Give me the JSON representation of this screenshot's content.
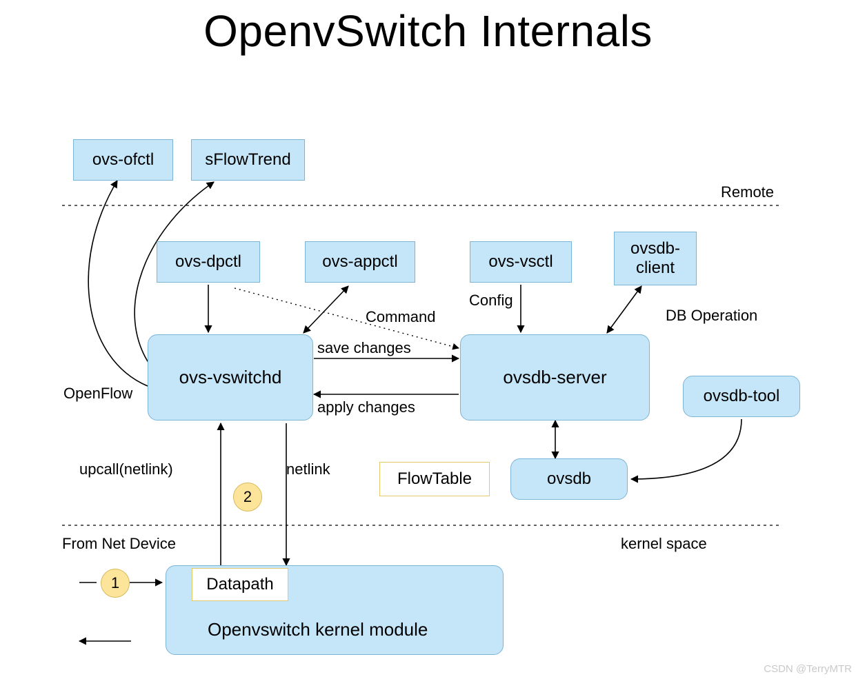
{
  "title": "OpenvSwitch Internals",
  "nodes": {
    "ovs_ofctl": "ovs-ofctl",
    "sflowtrend": "sFlowTrend",
    "ovs_dpctl": "ovs-dpctl",
    "ovs_appctl": "ovs-appctl",
    "ovs_vsctl": "ovs-vsctl",
    "ovsdb_client": "ovsdb-\nclient",
    "ovs_vswitchd": "ovs-vswitchd",
    "ovsdb_server": "ovsdb-server",
    "ovsdb_tool": "ovsdb-tool",
    "ovsdb": "ovsdb",
    "flowtable": "FlowTable",
    "datapath": "Datapath",
    "kernel_module": "Openvswitch kernel module"
  },
  "labels": {
    "remote": "Remote",
    "openflow": "OpenFlow",
    "command": "Command",
    "config": "Config",
    "db_operation": "DB Operation",
    "save_changes": "save changes",
    "apply_changes": "apply changes",
    "upcall": "upcall(netlink)",
    "netlink": "netlink",
    "from_net_device": "From Net Device",
    "kernel_space": "kernel space",
    "watermark": "CSDN @TerryMTR"
  },
  "badges": {
    "one": "1",
    "two": "2"
  }
}
